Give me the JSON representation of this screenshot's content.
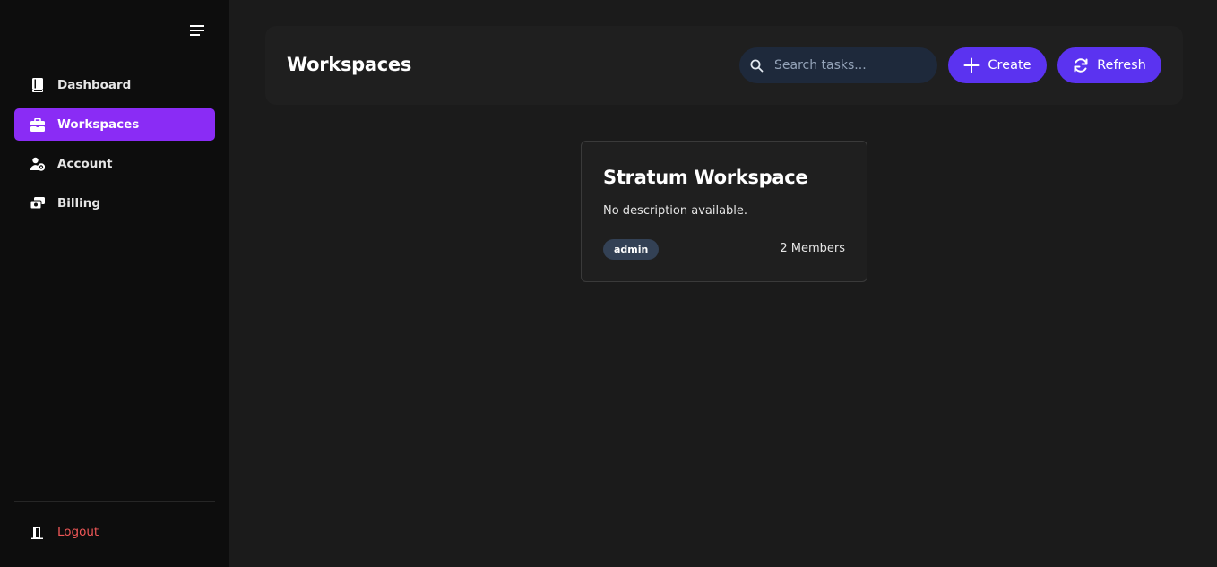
{
  "sidebar": {
    "menu_icon": "hamburger-menu-icon",
    "items": [
      {
        "label": "Dashboard",
        "icon": "book-icon",
        "active": false
      },
      {
        "label": "Workspaces",
        "icon": "briefcase-icon",
        "active": true
      },
      {
        "label": "Account",
        "icon": "user-gear-icon",
        "active": false
      },
      {
        "label": "Billing",
        "icon": "money-bill-icon",
        "active": false
      }
    ],
    "logout": {
      "label": "Logout",
      "icon": "door-exit-icon"
    }
  },
  "header": {
    "title": "Workspaces",
    "search": {
      "placeholder": "Search tasks...",
      "value": ""
    },
    "create_label": "Create",
    "refresh_label": "Refresh"
  },
  "workspaces": [
    {
      "name": "Stratum Workspace",
      "description": "No description available.",
      "role": "admin",
      "members": "2 Members"
    }
  ],
  "colors": {
    "accent_sidebar": "#8a2cf5",
    "button": "#5b33f0",
    "logout": "#ef5757",
    "search_bg": "#1e293b",
    "badge_bg": "#334155"
  }
}
